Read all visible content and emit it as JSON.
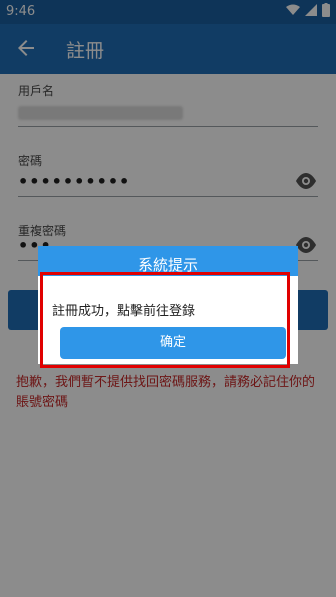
{
  "status_bar": {
    "time": "9:46"
  },
  "app_bar": {
    "title": "註冊"
  },
  "form": {
    "username_label": "用戶名",
    "password_label": "密碼",
    "password_value": "••••••••••",
    "confirm_password_label": "重複密碼",
    "confirm_password_value": "•••"
  },
  "warning_text": "抱歉，我們暫不提供找回密碼服務，請務必記住你的賬號密碼",
  "dialog": {
    "title": "系統提示",
    "message": "註冊成功，點擊前往登錄",
    "confirm_label": "确定"
  },
  "colors": {
    "app_bar": "#1f6db6",
    "dialog_accent": "#2f96e8",
    "warning": "#c62828",
    "highlight": "#e00000"
  }
}
